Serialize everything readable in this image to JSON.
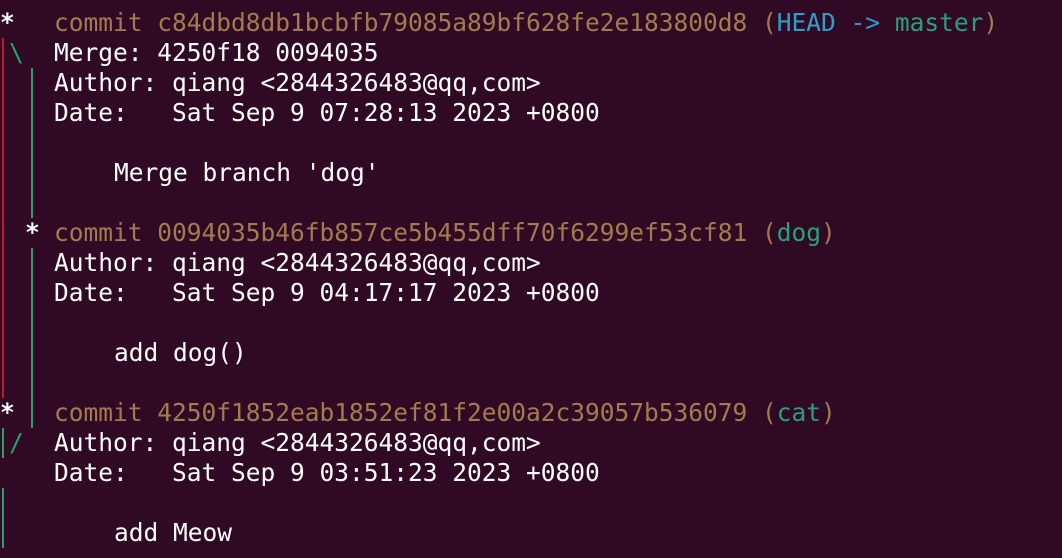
{
  "graph": {
    "star": "*",
    "merge_fork": "\\",
    "merge_join": "/"
  },
  "commits": [
    {
      "hash_line": "commit c84dbd8db1bcbfb79085a89bf628fe2e183800d8",
      "refs_open": " (",
      "head": "HEAD",
      "arrow": " -> ",
      "branch": "master",
      "refs_close": ")",
      "merge": "Merge: 4250f18 0094035",
      "author": "Author: qiang <2844326483@qq,com>",
      "date": "Date:   Sat Sep 9 07:28:13 2023 +0800",
      "message": "Merge branch 'dog'"
    },
    {
      "hash_line": "commit 0094035b46fb857ce5b455dff70f6299ef53cf81",
      "refs_open": " (",
      "branch": "dog",
      "refs_close": ")",
      "author": "Author: qiang <2844326483@qq,com>",
      "date": "Date:   Sat Sep 9 04:17:17 2023 +0800",
      "message": "add dog()"
    },
    {
      "hash_line": "commit 4250f1852eab1852ef81f2e00a2c39057b536079",
      "refs_open": " (",
      "branch": "cat",
      "refs_close": ")",
      "author": "Author: qiang <2844326483@qq,com>",
      "date": "Date:   Sat Sep 9 03:51:23 2023 +0800",
      "message": "add Meow"
    }
  ],
  "colors": {
    "background": "#300a24",
    "commit_hash": "#a47a4f",
    "head_ref": "#2e9ec9",
    "branch_ref": "#2aa07a",
    "graph_red": "#c01c28",
    "graph_green": "#26a269"
  }
}
